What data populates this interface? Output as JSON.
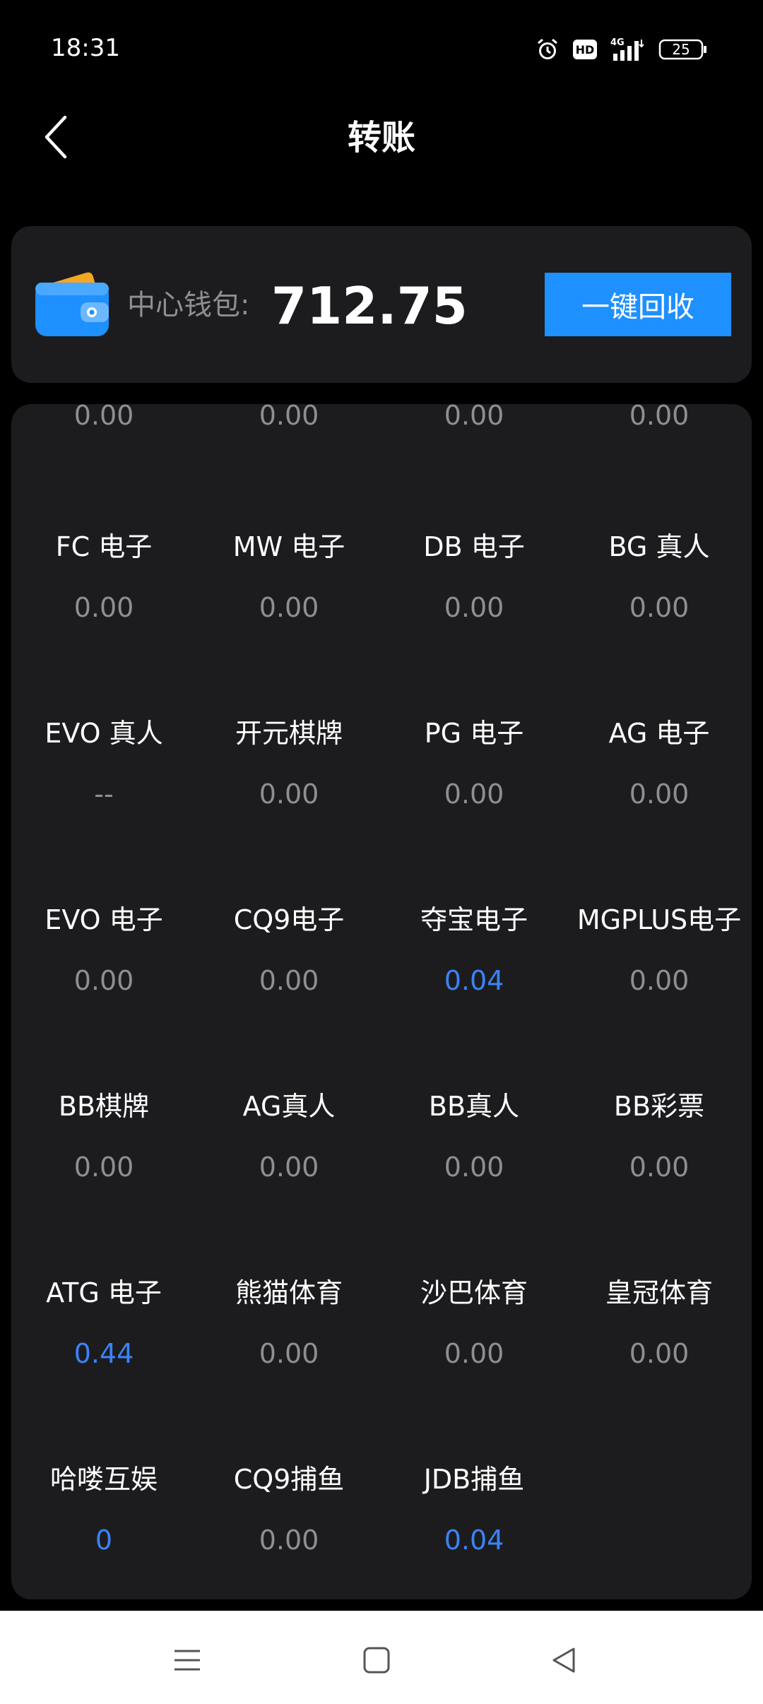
{
  "status_bar": {
    "time": "18:31",
    "network": "4G",
    "hd_label": "HD",
    "battery": "25"
  },
  "header": {
    "title": "转账",
    "back_icon": "chevron-left-icon"
  },
  "wallet": {
    "label": "中心钱包:",
    "amount": "712.75",
    "recycle_button": "一键回收",
    "icon": "wallet-icon",
    "accent_color": "#1e90ff"
  },
  "platforms": {
    "partial_row_values": [
      "0.00",
      "0.00",
      "0.00",
      "0.00"
    ],
    "rows": [
      [
        {
          "name": "FC 电子",
          "value": "0.00",
          "highlight": false
        },
        {
          "name": "MW 电子",
          "value": "0.00",
          "highlight": false
        },
        {
          "name": "DB 电子",
          "value": "0.00",
          "highlight": false
        },
        {
          "name": "BG 真人",
          "value": "0.00",
          "highlight": false
        }
      ],
      [
        {
          "name": "EVO 真人",
          "value": "--",
          "highlight": false
        },
        {
          "name": "开元棋牌",
          "value": "0.00",
          "highlight": false
        },
        {
          "name": "PG 电子",
          "value": "0.00",
          "highlight": false
        },
        {
          "name": "AG 电子",
          "value": "0.00",
          "highlight": false
        }
      ],
      [
        {
          "name": "EVO 电子",
          "value": "0.00",
          "highlight": false
        },
        {
          "name": "CQ9电子",
          "value": "0.00",
          "highlight": false
        },
        {
          "name": "夺宝电子",
          "value": "0.04",
          "highlight": true
        },
        {
          "name": "MGPLUS电子",
          "value": "0.00",
          "highlight": false
        }
      ],
      [
        {
          "name": "BB棋牌",
          "value": "0.00",
          "highlight": false
        },
        {
          "name": "AG真人",
          "value": "0.00",
          "highlight": false
        },
        {
          "name": "BB真人",
          "value": "0.00",
          "highlight": false
        },
        {
          "name": "BB彩票",
          "value": "0.00",
          "highlight": false
        }
      ],
      [
        {
          "name": "ATG 电子",
          "value": "0.44",
          "highlight": true
        },
        {
          "name": "熊猫体育",
          "value": "0.00",
          "highlight": false
        },
        {
          "name": "沙巴体育",
          "value": "0.00",
          "highlight": false
        },
        {
          "name": "皇冠体育",
          "value": "0.00",
          "highlight": false
        }
      ],
      [
        {
          "name": "哈喽互娱",
          "value": "0",
          "highlight": true
        },
        {
          "name": "CQ9捕鱼",
          "value": "0.00",
          "highlight": false
        },
        {
          "name": "JDB捕鱼",
          "value": "0.04",
          "highlight": true
        }
      ]
    ],
    "value_color": "#8e8e93",
    "highlight_color": "#3b82f6"
  },
  "nav_bar": {
    "items": [
      "menu-icon",
      "home-square-icon",
      "back-triangle-icon"
    ]
  }
}
